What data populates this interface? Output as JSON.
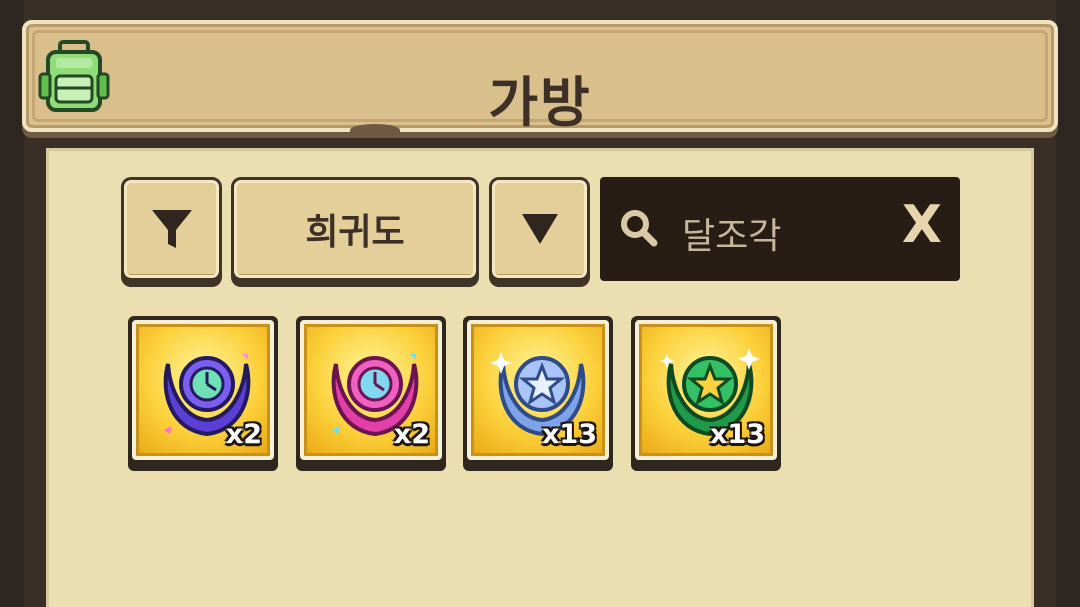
{
  "header": {
    "title": "가방",
    "icon": "backpack-icon"
  },
  "toolbar": {
    "filter_icon": "filter-icon",
    "rarity_label": "희귀도",
    "sort_icon": "triangle-down-icon",
    "search": {
      "value": "달조각",
      "icon": "search-icon",
      "clear_label": "X"
    }
  },
  "items": [
    {
      "name": "purple-moon-fragment",
      "quantity": "x2",
      "color": "#5b3fd6"
    },
    {
      "name": "pink-moon-fragment",
      "quantity": "x2",
      "color": "#e23fa8"
    },
    {
      "name": "blue-moon-fragment",
      "quantity": "x13",
      "color": "#7fa3e8"
    },
    {
      "name": "green-moon-fragment",
      "quantity": "x13",
      "color": "#1f9a4a"
    }
  ],
  "colors": {
    "panel": "#ebdfb1",
    "header": "#d8bf8c",
    "button": "#e4cf9a",
    "search_bg": "#271d15",
    "slot_gold": "#fbd03a"
  }
}
